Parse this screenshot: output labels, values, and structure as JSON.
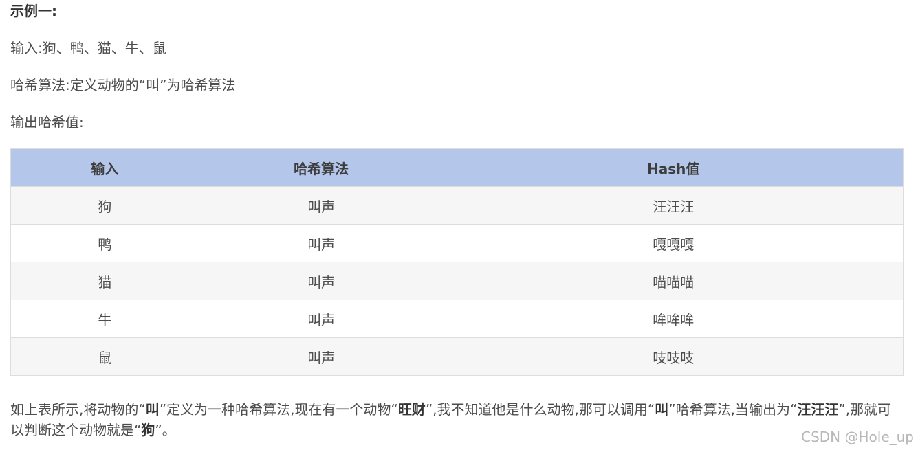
{
  "heading": "示例一:",
  "input_line": "输入:狗、鸭、猫、牛、鼠",
  "algorithm_line": "哈希算法:定义动物的“叫”为哈希算法",
  "output_line": "输出哈希值:",
  "table": {
    "headers": [
      "输入",
      "哈希算法",
      "Hash值"
    ],
    "rows": [
      [
        "狗",
        "叫声",
        "汪汪汪"
      ],
      [
        "鸭",
        "叫声",
        "嘎嘎嘎"
      ],
      [
        "猫",
        "叫声",
        "喵喵喵"
      ],
      [
        "牛",
        "叫声",
        "哞哞哞"
      ],
      [
        "鼠",
        "叫声",
        "吱吱吱"
      ]
    ]
  },
  "conclusion": {
    "part1": "如上表所示,将动物的“",
    "bold1": "叫",
    "part2": "”定义为一种哈希算法,现在有一个动物“",
    "bold2": "旺财",
    "part3": "”,我不知道他是什么动物,那可以调用“",
    "bold3": "叫",
    "part4": "”哈希算法,当输出为“",
    "bold4": "汪汪汪",
    "part5": "”,那就可以判断这个动物就是“",
    "bold5": "狗",
    "part6": "”。"
  },
  "watermark": "CSDN @Hole_up"
}
